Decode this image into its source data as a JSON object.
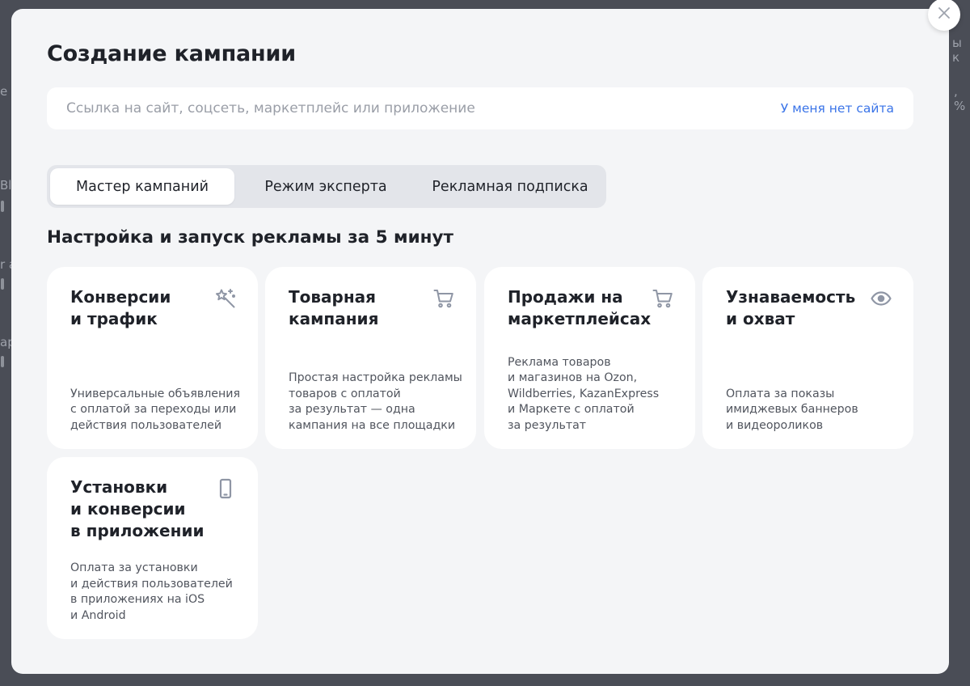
{
  "background": {
    "fragments": [
      "ы к",
      ", %",
      "е",
      "Bl",
      "r a",
      "ap"
    ]
  },
  "modal": {
    "title": "Создание кампании",
    "url_field": {
      "placeholder": "Ссылка на сайт, соцсеть, маркетплейс или приложение",
      "value": ""
    },
    "no_site_link": "У меня нет сайта",
    "tabs": [
      {
        "label": "Мастер кампаний",
        "active": true
      },
      {
        "label": "Режим эксперта",
        "active": false
      },
      {
        "label": "Рекламная подписка",
        "active": false
      }
    ],
    "section_title": "Настройка и запуск рекламы за 5 минут",
    "cards": [
      {
        "title": "Конверсии\nи трафик",
        "icon": "magic-wand-icon",
        "description": "Универсальные объявления\nс оплатой за переходы или\nдействия пользователей"
      },
      {
        "title": "Товарная\nкампания",
        "icon": "shopping-cart-icon",
        "description": "Простая настройка рекламы\nтоваров с оплатой\nза результат — одна\nкампания на все площадки"
      },
      {
        "title": "Продажи на\nмаркетплейсах",
        "icon": "shopping-cart-icon",
        "description": "Реклама товаров\nи магазинов на Ozon,\nWildberries, KazanExpress\nи Маркете с оплатой\nза результат"
      },
      {
        "title": "Узнаваемость\nи охват",
        "icon": "eye-icon",
        "description": "Оплата за показы\nимиджевых баннеров\nи видеороликов"
      },
      {
        "title": "Установки\nи конверсии\nв приложении",
        "icon": "smartphone-icon",
        "description": "Оплата за установки\nи действия пользователей\nв приложениях на iOS\nи Android"
      }
    ]
  },
  "colors": {
    "overlay": "#4a4d56",
    "modal_bg": "#f4f5f7",
    "card_bg": "#ffffff",
    "link": "#3a74e8",
    "icon": "#8f96a5",
    "text": "#1f2229"
  }
}
